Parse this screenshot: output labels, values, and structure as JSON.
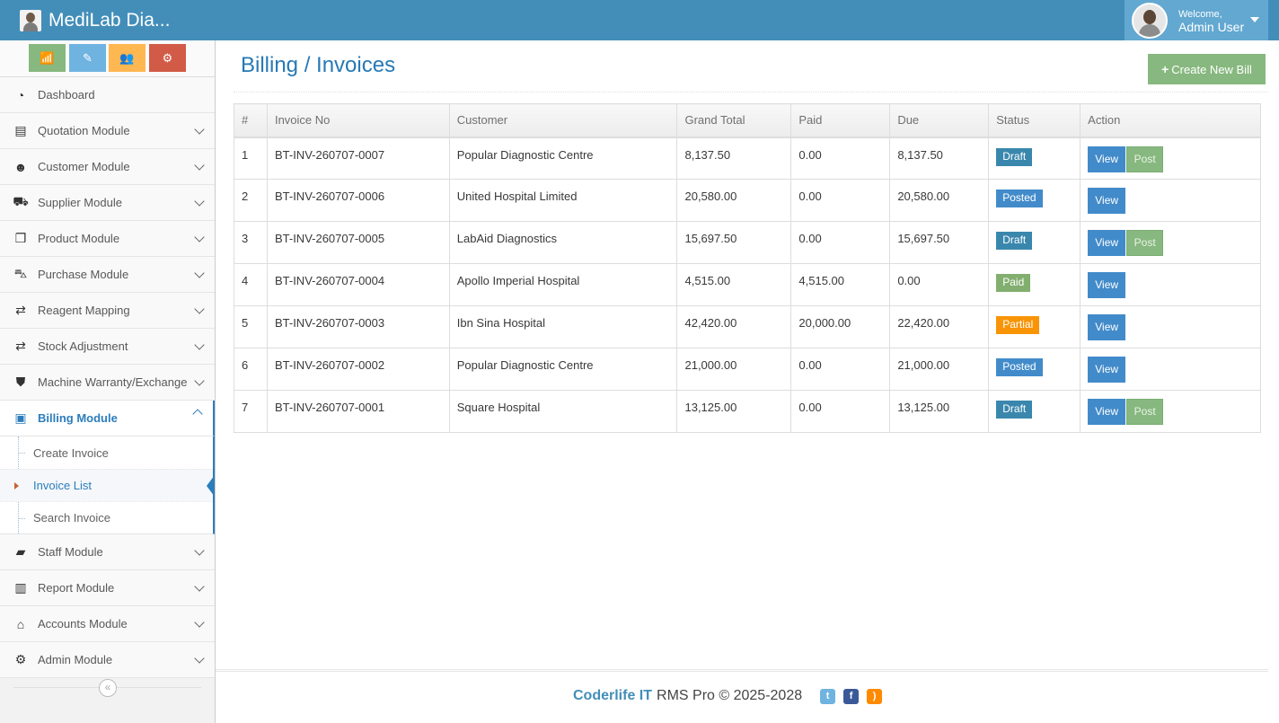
{
  "app": {
    "brand": "MediLab Dia..."
  },
  "user": {
    "welcome": "Welcome,",
    "name": "Admin User"
  },
  "shortcuts": [
    {
      "icon": "signal-icon",
      "glyph": "📶"
    },
    {
      "icon": "pencil-icon",
      "glyph": "✎"
    },
    {
      "icon": "users-icon",
      "glyph": "👥"
    },
    {
      "icon": "cogs-icon",
      "glyph": "⚙"
    }
  ],
  "sidebar": {
    "items": [
      {
        "label": "Dashboard",
        "icon": "tachometer-icon",
        "glyph": "◔"
      },
      {
        "label": "Quotation Module",
        "icon": "file-text-icon",
        "glyph": "▤"
      },
      {
        "label": "Customer Module",
        "icon": "users-icon",
        "glyph": "☻"
      },
      {
        "label": "Supplier Module",
        "icon": "truck-icon",
        "glyph": "⛟"
      },
      {
        "label": "Product Module",
        "icon": "cubes-icon",
        "glyph": "❒"
      },
      {
        "label": "Purchase Module",
        "icon": "shopping-cart-icon",
        "glyph": "⛍"
      },
      {
        "label": "Reagent Mapping",
        "icon": "exchange-icon",
        "glyph": "⇄"
      },
      {
        "label": "Stock Adjustment",
        "icon": "exchange-icon",
        "glyph": "⇄"
      },
      {
        "label": "Machine Warranty/Exchange",
        "icon": "shield-icon",
        "glyph": "⛊"
      },
      {
        "label": "Billing Module",
        "icon": "money-icon",
        "glyph": "▣"
      }
    ],
    "billing_submenu": [
      {
        "label": "Create Invoice"
      },
      {
        "label": "Invoice List"
      },
      {
        "label": "Search Invoice"
      }
    ],
    "items_after": [
      {
        "label": "Staff Module",
        "icon": "briefcase-icon",
        "glyph": "▰"
      },
      {
        "label": "Report Module",
        "icon": "bar-chart-icon",
        "glyph": "▥"
      },
      {
        "label": "Accounts Module",
        "icon": "bank-icon",
        "glyph": "⌂"
      },
      {
        "label": "Admin Module",
        "icon": "cog-icon",
        "glyph": "⚙"
      }
    ],
    "collapse_glyph": "«"
  },
  "page": {
    "title": "Billing / Invoices",
    "create_button": "Create New Bill",
    "create_plus": "+"
  },
  "table": {
    "headers": [
      "#",
      "Invoice No",
      "Customer",
      "Grand Total",
      "Paid",
      "Due",
      "Status",
      "Action"
    ],
    "rows": [
      {
        "num": "1",
        "invoice": "BT-INV-260707-0007",
        "customer": "Popular Diagnostic Centre",
        "total": "8,137.50",
        "paid": "0.00",
        "due": "8,137.50",
        "status": "Draft",
        "status_class": "b-draft",
        "has_post": true
      },
      {
        "num": "2",
        "invoice": "BT-INV-260707-0006",
        "customer": "United Hospital Limited",
        "total": "20,580.00",
        "paid": "0.00",
        "due": "20,580.00",
        "status": "Posted",
        "status_class": "b-posted",
        "has_post": false
      },
      {
        "num": "3",
        "invoice": "BT-INV-260707-0005",
        "customer": "LabAid Diagnostics",
        "total": "15,697.50",
        "paid": "0.00",
        "due": "15,697.50",
        "status": "Draft",
        "status_class": "b-draft",
        "has_post": true
      },
      {
        "num": "4",
        "invoice": "BT-INV-260707-0004",
        "customer": "Apollo Imperial Hospital",
        "total": "4,515.00",
        "paid": "4,515.00",
        "due": "0.00",
        "status": "Paid",
        "status_class": "b-paid",
        "has_post": false
      },
      {
        "num": "5",
        "invoice": "BT-INV-260707-0003",
        "customer": "Ibn Sina Hospital",
        "total": "42,420.00",
        "paid": "20,000.00",
        "due": "22,420.00",
        "status": "Partial",
        "status_class": "b-partial",
        "has_post": false
      },
      {
        "num": "6",
        "invoice": "BT-INV-260707-0002",
        "customer": "Popular Diagnostic Centre",
        "total": "21,000.00",
        "paid": "0.00",
        "due": "21,000.00",
        "status": "Posted",
        "status_class": "b-posted",
        "has_post": false
      },
      {
        "num": "7",
        "invoice": "BT-INV-260707-0001",
        "customer": "Square Hospital",
        "total": "13,125.00",
        "paid": "0.00",
        "due": "13,125.00",
        "status": "Draft",
        "status_class": "b-draft",
        "has_post": true
      }
    ],
    "view_label": "View",
    "post_label": "Post"
  },
  "footer": {
    "brand": "Coderlife IT",
    "text": "RMS Pro © 2025-2028",
    "social": [
      {
        "icon": "twitter-icon",
        "glyph": "t"
      },
      {
        "icon": "facebook-icon",
        "glyph": "f"
      },
      {
        "icon": "rss-icon",
        "glyph": ")"
      }
    ]
  },
  "colors": {
    "navbar": "#438eb9",
    "accent": "#2b7dbc",
    "draft": "#3a87ad",
    "posted": "#428bca",
    "paid": "#82af6f",
    "partial": "#f89406",
    "success": "#87b87f"
  }
}
